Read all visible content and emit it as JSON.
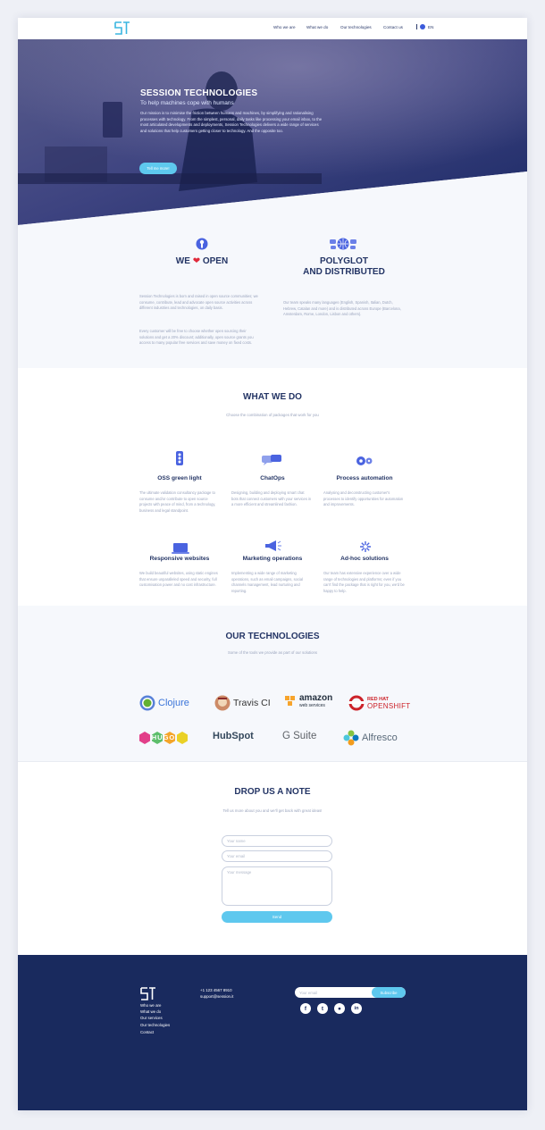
{
  "nav": {
    "links": [
      "Who we are",
      "What we do",
      "Our technologies",
      "Contact us"
    ],
    "lang": "EN"
  },
  "hero": {
    "title": "SESSION TECHNOLOGIES",
    "subtitle": "To help machines cope with humans",
    "text": "Our mission is to minimise the friction between humans and machines, by simplifying and rationalising processes with technology. From the simplest, personal, daily tasks like processing your email inbox, to the most articulated developments and deployments, Session Technologies delivers a wide range of services and solutions that help customers getting closer to technology. And the opposite too.",
    "button": "Tell me more!"
  },
  "values": [
    {
      "icon": "open-source-icon",
      "title_prefix": "WE",
      "title_suffix": "OPEN",
      "paragraphs": [
        "Session Technologies is born and raised in open source communities; we consume, contribute, lead and advocate open source activities across different industries and technologies, on daily basis.",
        "Every customer will be free to choose whether open sourcing their solutions and get a 20% discount; additionally, open source grants you access to many popular free services and save money on fixed costs."
      ]
    },
    {
      "icon": "globe-network-icon",
      "title_line1": "POLYGLOT",
      "title_line2": "AND DISTRIBUTED",
      "paragraphs": [
        "Our team speaks many languages (English, Spanish, Italian, Dutch, Hebrew, Catalan and more) and is distributed across Europe (Barcelona, Amsterdam, Rome, London, Lisbon and others)."
      ]
    }
  ],
  "what_we_do": {
    "title": "WHAT WE DO",
    "subtitle": "Choose the combination of packages that work for you",
    "services": [
      {
        "icon": "traffic-light-icon",
        "title": "OSS green light",
        "text": "The ultimate validation consultancy package to consume and/or contribute to open source projects with peace of mind, from a technology, business and legal standpoint."
      },
      {
        "icon": "chat-bubbles-icon",
        "title": "ChatOps",
        "text": "Designing, building and deploying smart chat bots that connect customers with your services in a more efficient and streamlined fashion."
      },
      {
        "icon": "gears-icon",
        "title": "Process automation",
        "text": "Analysing and deconstructing customer's processes to identify opportunities for automation and improvements."
      },
      {
        "icon": "laptop-icon",
        "title": "Responsive websites",
        "text": "We build beautiful websites, using static engines that ensure unparalleled speed and security, full customisation power and no cost infrastructure."
      },
      {
        "icon": "megaphone-icon",
        "title": "Marketing operations",
        "text": "Implementing a wide range of marketing operations, such as email campaigns, social channels management, lead nurturing and reporting."
      },
      {
        "icon": "sparkle-icon",
        "title": "Ad-hoc solutions",
        "text": "Our team has extensive experience over a wide range of technologies and platforms; even if you can't find the package that is right for you, we'd be happy to help."
      }
    ]
  },
  "technologies": {
    "title": "OUR TECHNOLOGIES",
    "subtitle": "Some of the tools we provide as part of our solutions",
    "items": [
      {
        "name": "Clojure",
        "color": "#3b74d9"
      },
      {
        "name": "Travis CI",
        "color": "#333333"
      },
      {
        "name": "amazon",
        "sub": "web services",
        "color": "#232f3e"
      },
      {
        "name": "RED HAT",
        "sub": "OPENSHIFT",
        "color": "#cc2229"
      },
      {
        "name": "HUGO",
        "color": "#ff4088"
      },
      {
        "name": "HubSpot",
        "color": "#33475b"
      },
      {
        "name": "G Suite",
        "color": "#5f6368"
      },
      {
        "name": "Alfresco",
        "color": "#5a6a7a"
      }
    ]
  },
  "contact": {
    "title": "DROP US A NOTE",
    "subtitle": "Tell us more about you and we'll get back with great ideas!",
    "name_placeholder": "Your name",
    "email_placeholder": "Your email",
    "message_placeholder": "Your message",
    "send": "Send"
  },
  "footer": {
    "links": [
      "Who we are",
      "What we do",
      "Our services",
      "Our technologies",
      "Contact"
    ],
    "phone": "+1 123 4567 8910",
    "email": "support@session.it",
    "subscribe_placeholder": "Your email",
    "subscribe_button": "Subscribe",
    "social": [
      "facebook-icon",
      "twitter-icon",
      "github-icon",
      "linkedin-icon"
    ]
  }
}
